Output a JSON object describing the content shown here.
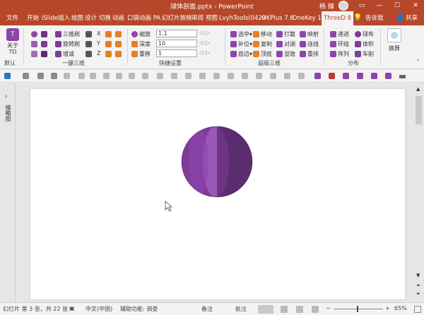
{
  "titlebar": {
    "title": "球体剖面.pptx  -  PowerPoint",
    "user": "杨 臻",
    "controls": [
      "▭",
      "—",
      "☐",
      "✕"
    ]
  },
  "tabs": [
    {
      "label": "文件"
    },
    {
      "label": "开始"
    },
    {
      "label": "iSlide"
    },
    {
      "label": "插入"
    },
    {
      "label": "绘图"
    },
    {
      "label": "设计"
    },
    {
      "label": "切换"
    },
    {
      "label": "动画"
    },
    {
      "label": "口袋动画 PA"
    },
    {
      "label": "幻灯片放映"
    },
    {
      "label": "审阅"
    },
    {
      "label": "视图"
    },
    {
      "label": "LvyhTools(0429"
    },
    {
      "label": "OKPlus 7.6"
    },
    {
      "label": "OneKey 10"
    },
    {
      "label": "ThreeD 8"
    },
    {
      "label": "告诉我"
    },
    {
      "label": "共享"
    }
  ],
  "ribbon": {
    "about": {
      "label": "关于\nTD",
      "group": "默认"
    },
    "onekey3d": {
      "items": [
        "三维刷",
        "旋转刷",
        "增减"
      ],
      "group": "一键三维"
    },
    "axes": [
      "X",
      "Y",
      "Z"
    ],
    "quick": {
      "scale_label": "缩放",
      "scale_value": "1.1",
      "depth_label": "深度",
      "depth_value": "10",
      "offset_label": "重移",
      "offset_value": "1",
      "group": "快捷设置"
    },
    "advanced": {
      "items": [
        "选中",
        "移动",
        "打散",
        "映射",
        "补位",
        "复制",
        "对调",
        "连线",
        "底边",
        "顶底",
        "显隐",
        "重排"
      ],
      "group": "超级三维"
    },
    "distribute": {
      "items": [
        "递进",
        "球布",
        "环绕",
        "体积",
        "阵列",
        "车削"
      ],
      "group": "分布"
    },
    "swap": {
      "label": "换算"
    }
  },
  "leftpane": {
    "label": "缩略图"
  },
  "status": {
    "slide_info": "幻灯片 第 3 张，共 22 张",
    "language": "中文(中国)",
    "accessibility": "辅助功能: 调查",
    "notes": "备注",
    "comments": "批注",
    "zoom": "65%"
  },
  "colors": {
    "accent": "#b7472a",
    "sphere_light": "#8e44ad",
    "sphere_dark": "#5b2c6f"
  }
}
